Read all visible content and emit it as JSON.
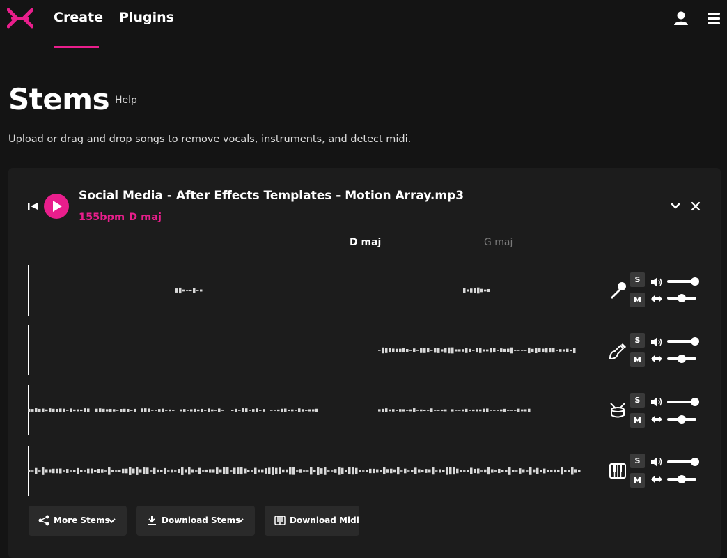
{
  "nav": {
    "create_label": "Create",
    "plugins_label": "Plugins"
  },
  "page": {
    "title": "Stems",
    "help_label": "Help",
    "subtitle": "Upload or drag and drop songs to remove vocals, instruments, and detect midi."
  },
  "track": {
    "title": "Social Media - After Effects Templates - Motion Array.mp3",
    "bpm": "155bpm",
    "key": "D maj",
    "chords": [
      "D maj",
      "G maj"
    ]
  },
  "stems": [
    {
      "name": "vocals",
      "icon": "microphone-icon",
      "solo_label": "S",
      "mute_label": "M",
      "volume": 1.0,
      "pan": 0.5
    },
    {
      "name": "guitar",
      "icon": "guitar-icon",
      "solo_label": "S",
      "mute_label": "M",
      "volume": 1.0,
      "pan": 0.5
    },
    {
      "name": "drums",
      "icon": "drum-icon",
      "solo_label": "S",
      "mute_label": "M",
      "volume": 1.0,
      "pan": 0.5
    },
    {
      "name": "piano",
      "icon": "piano-icon",
      "solo_label": "S",
      "mute_label": "M",
      "volume": 1.0,
      "pan": 0.5
    }
  ],
  "actions": {
    "more_stems_label": "More Stems",
    "download_stems_label": "Download Stems",
    "download_midi_label": "Download Midi"
  },
  "colors": {
    "accent": "#e91e8c",
    "background": "#141414",
    "card": "#1c1c1c"
  }
}
